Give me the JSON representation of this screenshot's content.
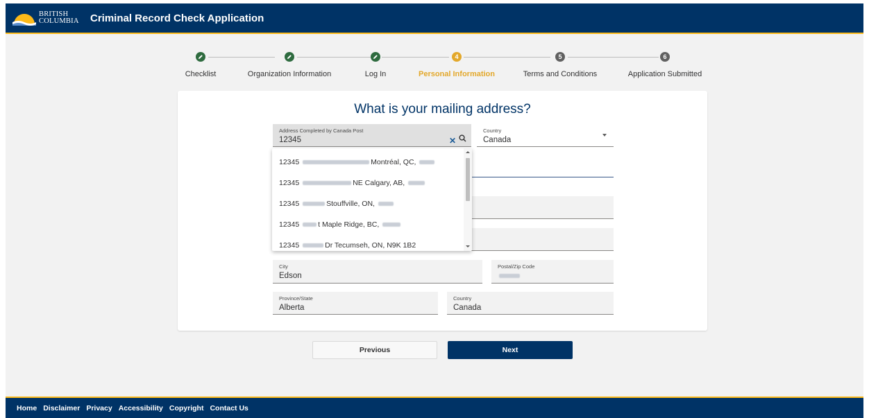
{
  "header": {
    "logo_line1": "BRITISH",
    "logo_line2": "COLUMBIA",
    "title": "Criminal Record Check Application"
  },
  "stepper": {
    "steps": [
      {
        "label": "Checklist",
        "state": "done",
        "icon": "pencil-icon"
      },
      {
        "label": "Organization Information",
        "state": "done",
        "icon": "pencil-icon"
      },
      {
        "label": "Log In",
        "state": "done",
        "icon": "pencil-icon"
      },
      {
        "label": "Personal Information",
        "state": "active",
        "number": "4"
      },
      {
        "label": "Terms and Conditions",
        "state": "todo",
        "number": "5"
      },
      {
        "label": "Application Submitted",
        "state": "todo",
        "number": "6"
      }
    ]
  },
  "form": {
    "title": "What is your mailing address?",
    "address_search": {
      "label": "Address Completed by Canada Post",
      "value": "12345"
    },
    "country_select": {
      "label": "Country",
      "value": "Canada"
    },
    "city": {
      "label": "City",
      "value": "Edson"
    },
    "postal": {
      "label": "Postal/Zip Code",
      "value": ""
    },
    "province": {
      "label": "Province/State",
      "value": "Alberta"
    },
    "country": {
      "label": "Country",
      "value": "Canada"
    }
  },
  "suggestions": [
    {
      "prefix": "12345",
      "suffix": "Montréal, QC,"
    },
    {
      "prefix": "12345",
      "suffix": "NE Calgary, AB,"
    },
    {
      "prefix": "12345",
      "suffix": "Stouffville, ON,"
    },
    {
      "prefix": "12345",
      "suffix": "t Maple Ridge, BC,"
    },
    {
      "prefix": "12345",
      "suffix": "Dr Tecumseh, ON, N9K 1B2"
    }
  ],
  "buttons": {
    "previous": "Previous",
    "next": "Next"
  },
  "footer": {
    "links": [
      "Home",
      "Disclaimer",
      "Privacy",
      "Accessibility",
      "Copyright",
      "Contact Us"
    ]
  },
  "colors": {
    "brand_blue": "#003366",
    "gold": "#fcba19",
    "active_step": "#e3a82b",
    "done_step": "#2e6b3f"
  }
}
